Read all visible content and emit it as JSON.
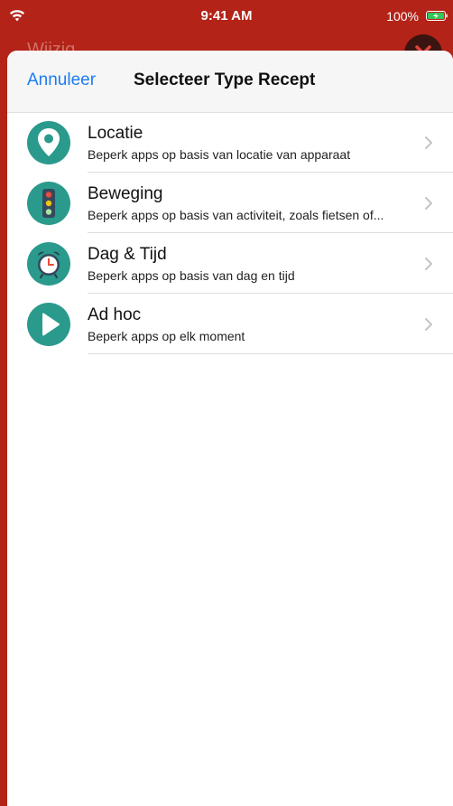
{
  "status_bar": {
    "time": "9:41 AM",
    "battery_percent": "100%"
  },
  "background": {
    "title": "Wijzig"
  },
  "nav_bar": {
    "cancel_label": "Annuleer",
    "title": "Selecteer Type Recept"
  },
  "recipe_types": [
    {
      "title": "Locatie",
      "subtitle": "Beperk apps op basis van locatie van apparaat",
      "icon": "location-pin-icon"
    },
    {
      "title": "Beweging",
      "subtitle": "Beperk apps op basis van activiteit, zoals fietsen of...",
      "icon": "traffic-light-icon"
    },
    {
      "title": "Dag & Tijd",
      "subtitle": "Beperk apps op basis van dag en tijd",
      "icon": "alarm-clock-icon"
    },
    {
      "title": "Ad hoc",
      "subtitle": "Beperk apps op elk moment",
      "icon": "play-icon"
    }
  ],
  "colors": {
    "accent_blue": "#1d7cf2",
    "icon_teal": "#2a9a8c",
    "app_red": "#b32317",
    "battery_green": "#34c759"
  }
}
